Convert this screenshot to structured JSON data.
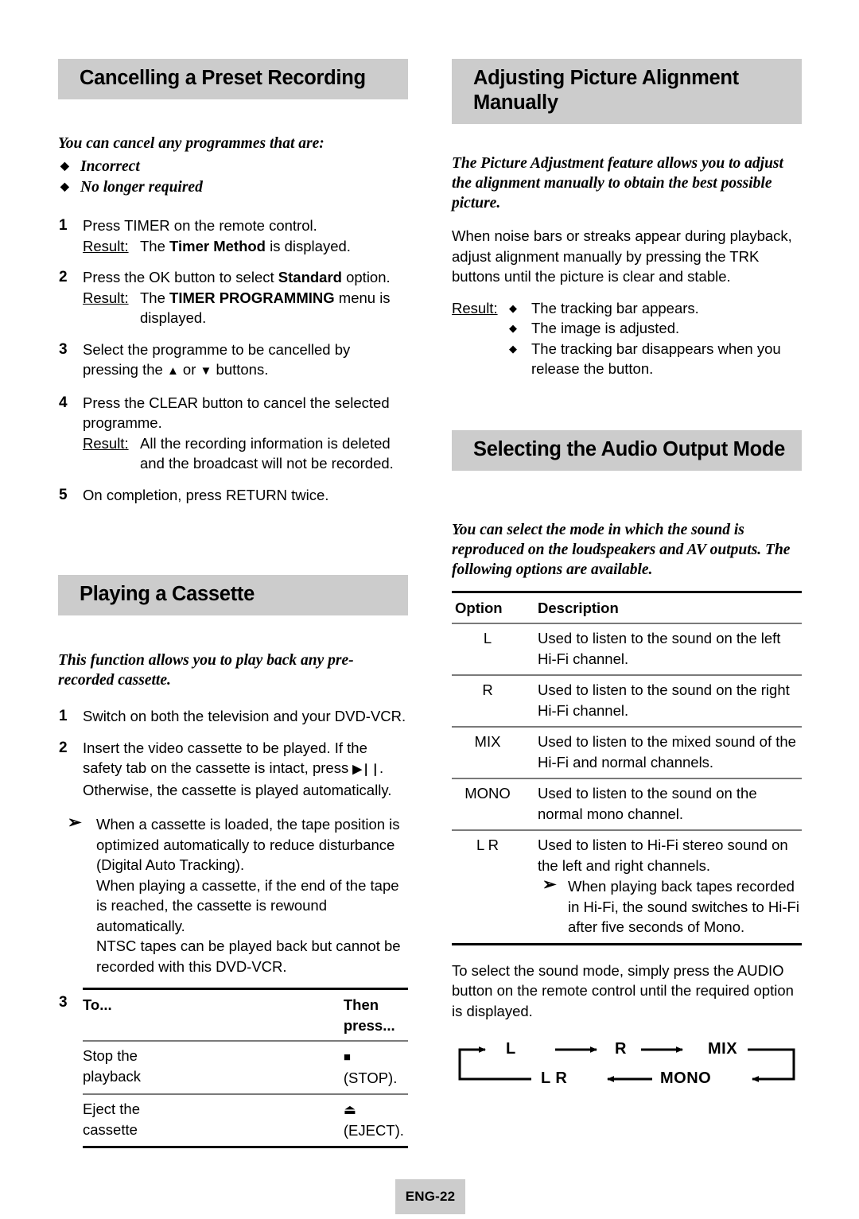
{
  "page": {
    "footer_label": "ENG-22"
  },
  "left_column": {
    "section1": {
      "heading": "Cancelling a Preset Recording",
      "intro": "You can cancel any programmes that are:",
      "bullets": [
        "Incorrect",
        "No longer required"
      ],
      "steps": [
        {
          "num": "1",
          "text": "Press TIMER on the remote control.",
          "result_label": "Result:",
          "result_pre": "The ",
          "result_bold": "Timer Method",
          "result_post": " is displayed."
        },
        {
          "num": "2",
          "text_pre": "Press the OK button to select ",
          "text_bold": "Standard",
          "text_post": " option.",
          "result_label": "Result:",
          "result_pre": "The ",
          "result_bold": "TIMER PROGRAMMING",
          "result_post": " menu is displayed."
        },
        {
          "num": "3",
          "text_pre": "Select the programme to be cancelled by pressing the ",
          "up_arrow": "▲",
          "text_mid": " or ",
          "down_arrow": "▼",
          "text_post": " buttons."
        },
        {
          "num": "4",
          "text": "Press the CLEAR button to cancel the selected programme.",
          "result_label": "Result:",
          "result_text": "All the recording information is deleted and the broadcast will not be recorded."
        },
        {
          "num": "5",
          "text": "On completion, press RETURN twice."
        }
      ]
    },
    "section2": {
      "heading": "Playing a Cassette",
      "intro": "This function allows you to play back any pre-recorded cassette.",
      "steps": [
        {
          "num": "1",
          "text": "Switch on both the television and your DVD-VCR."
        },
        {
          "num": "2",
          "text_pre": "Insert the video cassette to be played. If the safety tab on the cassette is intact, press ",
          "play_pause_icon": "▶❘❘",
          "text_post": ". Otherwise, the cassette is played automatically."
        }
      ],
      "note_arrow": "➢",
      "note_lines": [
        "When a cassette is loaded, the tape position is optimized automatically to reduce disturbance (Digital Auto Tracking).",
        "When playing a cassette, if the end of the tape is reached, the cassette is rewound automatically.",
        "NTSC tapes can be played back but cannot be recorded with this DVD-VCR."
      ],
      "table": {
        "step_num": "3",
        "headers": [
          "To...",
          "Then press..."
        ],
        "rows": [
          {
            "to": "Stop the playback",
            "icon": "■",
            "press": "(STOP)."
          },
          {
            "to": "Eject the cassette",
            "icon": "⏏",
            "press": "(EJECT)."
          }
        ]
      }
    }
  },
  "right_column": {
    "section1": {
      "heading": "Adjusting Picture Alignment Manually",
      "intro": "The Picture Adjustment feature allows you to adjust the alignment manually to obtain the best possible picture.",
      "body": "When noise bars or streaks appear during playback, adjust alignment manually by pressing the TRK buttons until the picture is clear and stable.",
      "result_label": "Result:",
      "result_bullets": [
        "The tracking bar appears.",
        "The image is adjusted.",
        "The tracking bar disappears when you release the button."
      ]
    },
    "section2": {
      "heading": "Selecting the Audio Output Mode",
      "intro": "You can select the mode in which the sound is reproduced on the loudspeakers and AV outputs. The following options are available.",
      "table": {
        "headers": [
          "Option",
          "Description"
        ],
        "rows": [
          {
            "option": "L",
            "description": "Used to listen to the sound on the left Hi-Fi channel."
          },
          {
            "option": "R",
            "description": "Used to listen to the sound on the right Hi-Fi channel."
          },
          {
            "option": "MIX",
            "description": "Used to listen to the mixed sound of the Hi-Fi and normal channels."
          },
          {
            "option": "MONO",
            "description": "Used to listen to the sound on the normal mono channel."
          },
          {
            "option": "L R",
            "description": "Used to listen to Hi-Fi stereo sound on the left and right channels.",
            "note_arrow": "➢",
            "note": "When playing back tapes recorded in Hi-Fi, the sound switches to Hi-Fi after five seconds of Mono."
          }
        ]
      },
      "outro": "To select the sound mode, simply press the AUDIO button on the remote control until the required option is displayed.",
      "cycle_diagram": {
        "labels": [
          "L",
          "R",
          "MIX",
          "MONO",
          "L R"
        ]
      }
    }
  }
}
